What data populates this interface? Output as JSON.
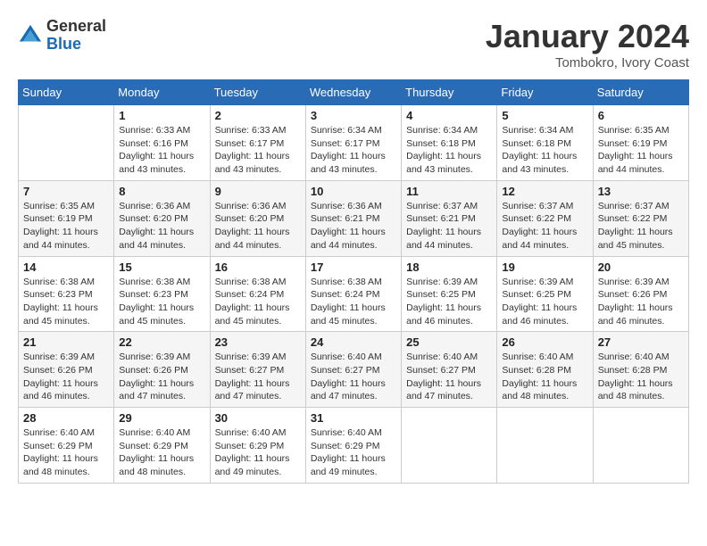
{
  "logo": {
    "general": "General",
    "blue": "Blue"
  },
  "title": {
    "month": "January 2024",
    "location": "Tombokro, Ivory Coast"
  },
  "weekdays": [
    "Sunday",
    "Monday",
    "Tuesday",
    "Wednesday",
    "Thursday",
    "Friday",
    "Saturday"
  ],
  "weeks": [
    [
      {
        "day": "",
        "sunrise": "",
        "sunset": "",
        "daylight": ""
      },
      {
        "day": "1",
        "sunrise": "Sunrise: 6:33 AM",
        "sunset": "Sunset: 6:16 PM",
        "daylight": "Daylight: 11 hours and 43 minutes."
      },
      {
        "day": "2",
        "sunrise": "Sunrise: 6:33 AM",
        "sunset": "Sunset: 6:17 PM",
        "daylight": "Daylight: 11 hours and 43 minutes."
      },
      {
        "day": "3",
        "sunrise": "Sunrise: 6:34 AM",
        "sunset": "Sunset: 6:17 PM",
        "daylight": "Daylight: 11 hours and 43 minutes."
      },
      {
        "day": "4",
        "sunrise": "Sunrise: 6:34 AM",
        "sunset": "Sunset: 6:18 PM",
        "daylight": "Daylight: 11 hours and 43 minutes."
      },
      {
        "day": "5",
        "sunrise": "Sunrise: 6:34 AM",
        "sunset": "Sunset: 6:18 PM",
        "daylight": "Daylight: 11 hours and 43 minutes."
      },
      {
        "day": "6",
        "sunrise": "Sunrise: 6:35 AM",
        "sunset": "Sunset: 6:19 PM",
        "daylight": "Daylight: 11 hours and 44 minutes."
      }
    ],
    [
      {
        "day": "7",
        "sunrise": "Sunrise: 6:35 AM",
        "sunset": "Sunset: 6:19 PM",
        "daylight": "Daylight: 11 hours and 44 minutes."
      },
      {
        "day": "8",
        "sunrise": "Sunrise: 6:36 AM",
        "sunset": "Sunset: 6:20 PM",
        "daylight": "Daylight: 11 hours and 44 minutes."
      },
      {
        "day": "9",
        "sunrise": "Sunrise: 6:36 AM",
        "sunset": "Sunset: 6:20 PM",
        "daylight": "Daylight: 11 hours and 44 minutes."
      },
      {
        "day": "10",
        "sunrise": "Sunrise: 6:36 AM",
        "sunset": "Sunset: 6:21 PM",
        "daylight": "Daylight: 11 hours and 44 minutes."
      },
      {
        "day": "11",
        "sunrise": "Sunrise: 6:37 AM",
        "sunset": "Sunset: 6:21 PM",
        "daylight": "Daylight: 11 hours and 44 minutes."
      },
      {
        "day": "12",
        "sunrise": "Sunrise: 6:37 AM",
        "sunset": "Sunset: 6:22 PM",
        "daylight": "Daylight: 11 hours and 44 minutes."
      },
      {
        "day": "13",
        "sunrise": "Sunrise: 6:37 AM",
        "sunset": "Sunset: 6:22 PM",
        "daylight": "Daylight: 11 hours and 45 minutes."
      }
    ],
    [
      {
        "day": "14",
        "sunrise": "Sunrise: 6:38 AM",
        "sunset": "Sunset: 6:23 PM",
        "daylight": "Daylight: 11 hours and 45 minutes."
      },
      {
        "day": "15",
        "sunrise": "Sunrise: 6:38 AM",
        "sunset": "Sunset: 6:23 PM",
        "daylight": "Daylight: 11 hours and 45 minutes."
      },
      {
        "day": "16",
        "sunrise": "Sunrise: 6:38 AM",
        "sunset": "Sunset: 6:24 PM",
        "daylight": "Daylight: 11 hours and 45 minutes."
      },
      {
        "day": "17",
        "sunrise": "Sunrise: 6:38 AM",
        "sunset": "Sunset: 6:24 PM",
        "daylight": "Daylight: 11 hours and 45 minutes."
      },
      {
        "day": "18",
        "sunrise": "Sunrise: 6:39 AM",
        "sunset": "Sunset: 6:25 PM",
        "daylight": "Daylight: 11 hours and 46 minutes."
      },
      {
        "day": "19",
        "sunrise": "Sunrise: 6:39 AM",
        "sunset": "Sunset: 6:25 PM",
        "daylight": "Daylight: 11 hours and 46 minutes."
      },
      {
        "day": "20",
        "sunrise": "Sunrise: 6:39 AM",
        "sunset": "Sunset: 6:26 PM",
        "daylight": "Daylight: 11 hours and 46 minutes."
      }
    ],
    [
      {
        "day": "21",
        "sunrise": "Sunrise: 6:39 AM",
        "sunset": "Sunset: 6:26 PM",
        "daylight": "Daylight: 11 hours and 46 minutes."
      },
      {
        "day": "22",
        "sunrise": "Sunrise: 6:39 AM",
        "sunset": "Sunset: 6:26 PM",
        "daylight": "Daylight: 11 hours and 47 minutes."
      },
      {
        "day": "23",
        "sunrise": "Sunrise: 6:39 AM",
        "sunset": "Sunset: 6:27 PM",
        "daylight": "Daylight: 11 hours and 47 minutes."
      },
      {
        "day": "24",
        "sunrise": "Sunrise: 6:40 AM",
        "sunset": "Sunset: 6:27 PM",
        "daylight": "Daylight: 11 hours and 47 minutes."
      },
      {
        "day": "25",
        "sunrise": "Sunrise: 6:40 AM",
        "sunset": "Sunset: 6:27 PM",
        "daylight": "Daylight: 11 hours and 47 minutes."
      },
      {
        "day": "26",
        "sunrise": "Sunrise: 6:40 AM",
        "sunset": "Sunset: 6:28 PM",
        "daylight": "Daylight: 11 hours and 48 minutes."
      },
      {
        "day": "27",
        "sunrise": "Sunrise: 6:40 AM",
        "sunset": "Sunset: 6:28 PM",
        "daylight": "Daylight: 11 hours and 48 minutes."
      }
    ],
    [
      {
        "day": "28",
        "sunrise": "Sunrise: 6:40 AM",
        "sunset": "Sunset: 6:29 PM",
        "daylight": "Daylight: 11 hours and 48 minutes."
      },
      {
        "day": "29",
        "sunrise": "Sunrise: 6:40 AM",
        "sunset": "Sunset: 6:29 PM",
        "daylight": "Daylight: 11 hours and 48 minutes."
      },
      {
        "day": "30",
        "sunrise": "Sunrise: 6:40 AM",
        "sunset": "Sunset: 6:29 PM",
        "daylight": "Daylight: 11 hours and 49 minutes."
      },
      {
        "day": "31",
        "sunrise": "Sunrise: 6:40 AM",
        "sunset": "Sunset: 6:29 PM",
        "daylight": "Daylight: 11 hours and 49 minutes."
      },
      {
        "day": "",
        "sunrise": "",
        "sunset": "",
        "daylight": ""
      },
      {
        "day": "",
        "sunrise": "",
        "sunset": "",
        "daylight": ""
      },
      {
        "day": "",
        "sunrise": "",
        "sunset": "",
        "daylight": ""
      }
    ]
  ]
}
